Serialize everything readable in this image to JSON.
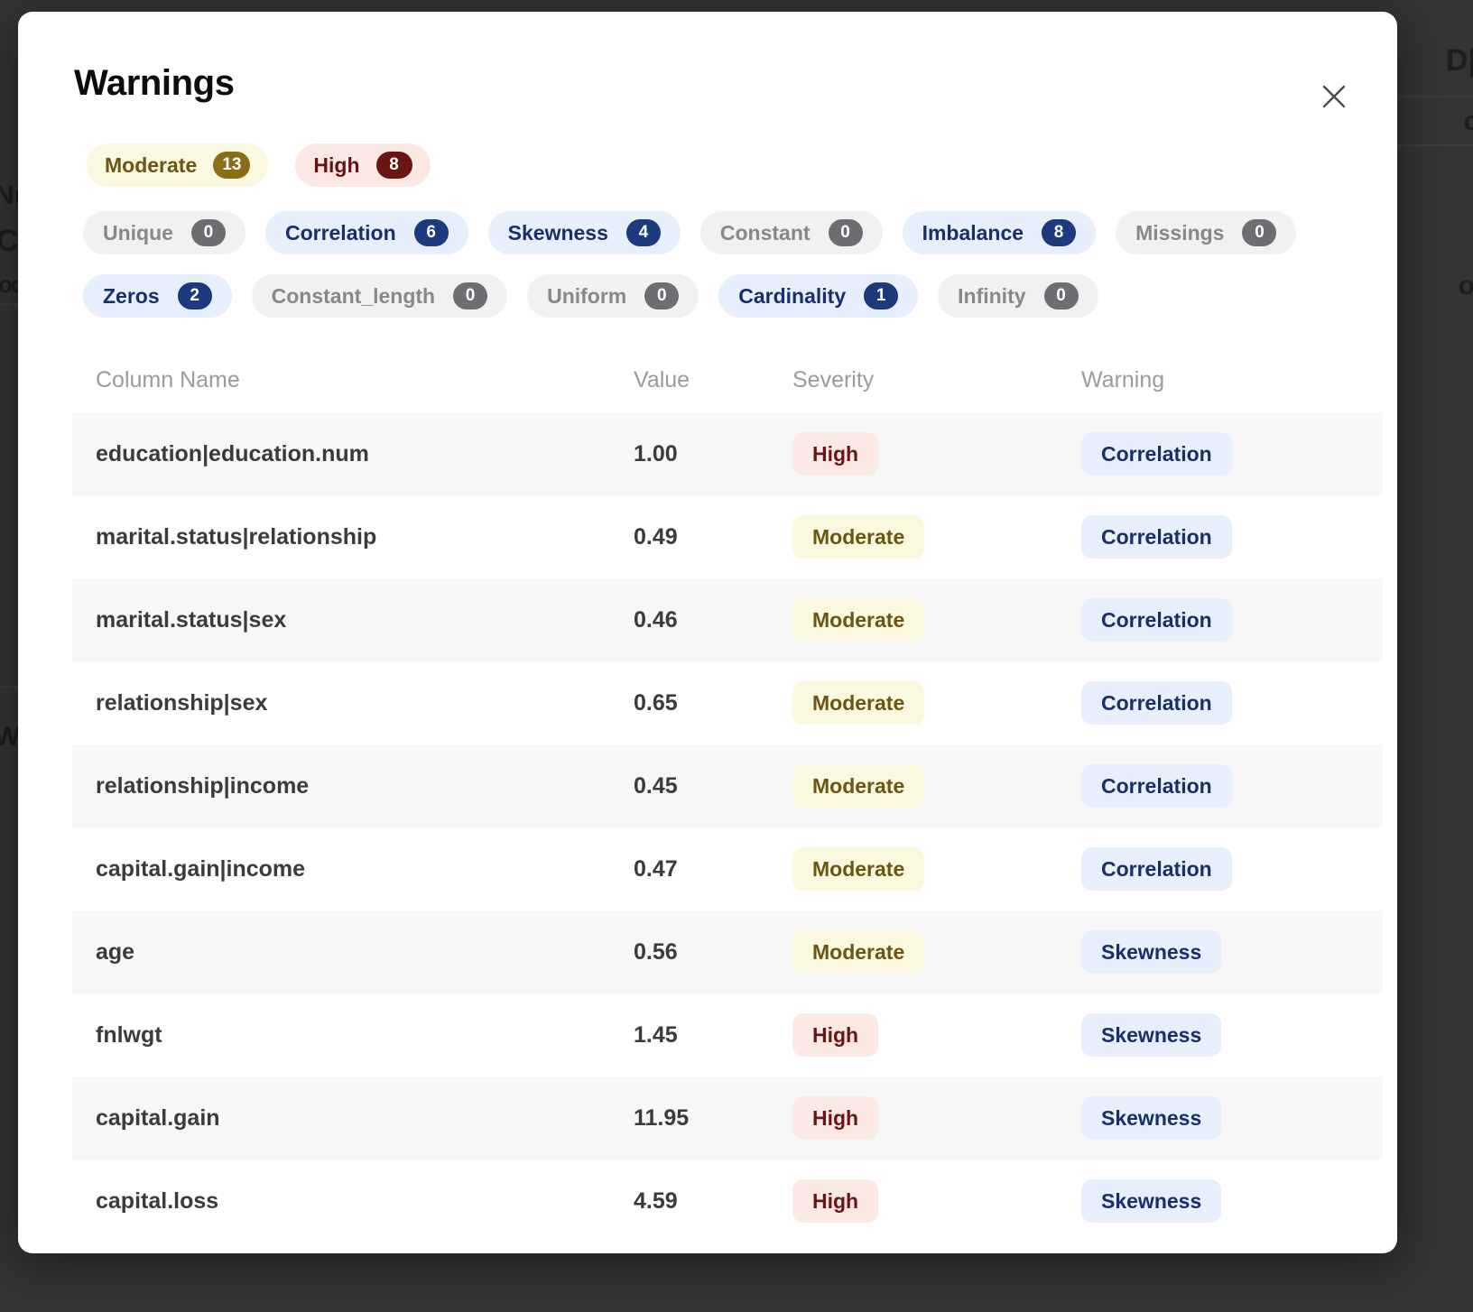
{
  "background": {
    "ghost_texts": [
      "Nu",
      "C",
      "ooo",
      "W",
      "D|",
      "c",
      "o"
    ]
  },
  "modal": {
    "title": "Warnings",
    "close_icon": "close-icon"
  },
  "severity_filters": [
    {
      "label": "Moderate",
      "count": "13",
      "state": "selected",
      "tone": "moderate"
    },
    {
      "label": "High",
      "count": "8",
      "state": "selected",
      "tone": "high"
    }
  ],
  "type_filters": [
    {
      "label": "Unique",
      "count": "0",
      "state": "off"
    },
    {
      "label": "Correlation",
      "count": "6",
      "state": "on"
    },
    {
      "label": "Skewness",
      "count": "4",
      "state": "on"
    },
    {
      "label": "Constant",
      "count": "0",
      "state": "off"
    },
    {
      "label": "Imbalance",
      "count": "8",
      "state": "on"
    },
    {
      "label": "Missings",
      "count": "0",
      "state": "off"
    },
    {
      "label": "Zeros",
      "count": "2",
      "state": "on"
    },
    {
      "label": "Constant_length",
      "count": "0",
      "state": "off"
    },
    {
      "label": "Uniform",
      "count": "0",
      "state": "off"
    },
    {
      "label": "Cardinality",
      "count": "1",
      "state": "on"
    },
    {
      "label": "Infinity",
      "count": "0",
      "state": "off"
    }
  ],
  "table": {
    "columns": [
      "Column Name",
      "Value",
      "Severity",
      "Warning"
    ],
    "rows": [
      {
        "column_name": "education|education.num",
        "value": "1.00",
        "severity": "High",
        "warning": "Correlation"
      },
      {
        "column_name": "marital.status|relationship",
        "value": "0.49",
        "severity": "Moderate",
        "warning": "Correlation"
      },
      {
        "column_name": "marital.status|sex",
        "value": "0.46",
        "severity": "Moderate",
        "warning": "Correlation"
      },
      {
        "column_name": "relationship|sex",
        "value": "0.65",
        "severity": "Moderate",
        "warning": "Correlation"
      },
      {
        "column_name": "relationship|income",
        "value": "0.45",
        "severity": "Moderate",
        "warning": "Correlation"
      },
      {
        "column_name": "capital.gain|income",
        "value": "0.47",
        "severity": "Moderate",
        "warning": "Correlation"
      },
      {
        "column_name": "age",
        "value": "0.56",
        "severity": "Moderate",
        "warning": "Skewness"
      },
      {
        "column_name": "fnlwgt",
        "value": "1.45",
        "severity": "High",
        "warning": "Skewness"
      },
      {
        "column_name": "capital.gain",
        "value": "11.95",
        "severity": "High",
        "warning": "Skewness"
      },
      {
        "column_name": "capital.loss",
        "value": "4.59",
        "severity": "High",
        "warning": "Skewness"
      }
    ]
  },
  "colors": {
    "backdrop": "#333436",
    "modal_bg": "#ffffff",
    "accent_navy": "#1c3a7d",
    "badge_blue_bg": "#e7eefc",
    "moderate_bg": "#fbf8e0",
    "moderate_fg": "#6b5511",
    "high_bg": "#fbeae3",
    "high_fg": "#6b1414",
    "row_alt": "#f7f7f8",
    "header_fg": "#9a9aa0"
  }
}
